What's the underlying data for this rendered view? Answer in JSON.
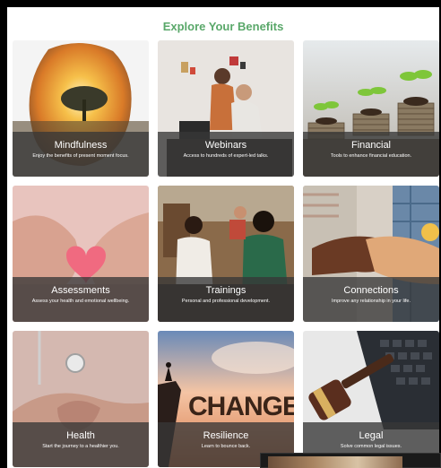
{
  "page": {
    "heading": "Explore Your Benefits"
  },
  "benefits": [
    {
      "title": "Mindfulness",
      "description": "Enjoy the benefits of present moment focus.",
      "image_icon": "tree-sunset-icon"
    },
    {
      "title": "Webinars",
      "description": "Access to hundreds of expert-led talks.",
      "image_icon": "people-laptop-icon"
    },
    {
      "title": "Financial",
      "description": "Tools to enhance financial education.",
      "image_icon": "coin-stacks-plant-icon"
    },
    {
      "title": "Assessments",
      "description": "Assess your health and emotional wellbeing.",
      "image_icon": "hands-heart-icon"
    },
    {
      "title": "Trainings",
      "description": "Personal and professional development.",
      "image_icon": "students-smiling-icon"
    },
    {
      "title": "Connections",
      "description": "Improve any relationship in your life.",
      "image_icon": "handshake-icon"
    },
    {
      "title": "Health",
      "description": "Start the journey to a healthier you.",
      "image_icon": "stethoscope-icon"
    },
    {
      "title": "Resilience",
      "description": "Learn to bounce back.",
      "image_icon": "change-cliff-icon"
    },
    {
      "title": "Legal",
      "description": "Solve common legal issues.",
      "image_icon": "gavel-keyboard-icon"
    }
  ],
  "colors": {
    "heading": "#5aa86a",
    "caption_bg": "rgba(55,55,55,0.78)",
    "caption_text": "#ffffff"
  }
}
